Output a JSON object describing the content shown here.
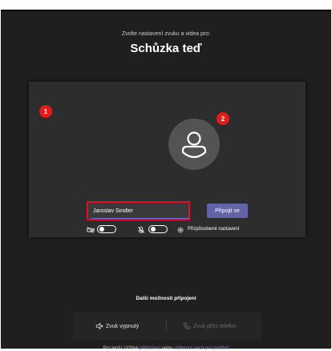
{
  "header": {
    "subtitle": "Zvolte nastavení zvuku a videa pro:",
    "title": "Schůzka teď"
  },
  "preview": {
    "name_value": "Jaroslav Šindler",
    "join_label": "Připojit se",
    "callouts": [
      "1",
      "2"
    ],
    "camera_icon": "camera-off-icon",
    "camera_enabled": false,
    "mic_icon": "mic-off-icon",
    "mic_enabled": false,
    "settings_icon": "gear-icon",
    "custom_settings_label": "Přizpůsobené nastavení"
  },
  "more": {
    "title": "Další možnosti připojení",
    "audio_off_label": "Zvuk vypnutý",
    "audio_off_icon": "speaker-off-icon",
    "phone_label": "Zvuk přes telefon",
    "phone_icon": "phone-icon"
  },
  "footer": {
    "prefix": "Pro lepší zážitek",
    "signin_link": "přihlášení",
    "middle": "nebo",
    "download_link": "stáhnout verzi pro počítač"
  },
  "colors": {
    "accent": "#6264a7",
    "callout": "#e31b1b",
    "background": "#1f1f1f",
    "card": "#2d2d2d"
  }
}
